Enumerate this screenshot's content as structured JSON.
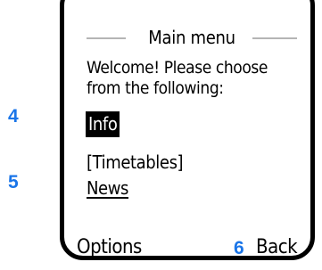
{
  "screen": {
    "title": "Main menu",
    "welcome_line1": "Welcome! Please choose",
    "welcome_line2": "from the following:",
    "menu": [
      {
        "label": "Info"
      },
      {
        "label": "[Timetables]"
      },
      {
        "label": "News"
      }
    ],
    "softkeys": {
      "left": "Options",
      "right": "Back"
    }
  },
  "callouts": [
    "4",
    "5",
    "6"
  ],
  "colors": {
    "callout": "#1a75e8",
    "title_line": "#b5b5b5",
    "highlight_bg": "#000000",
    "highlight_fg": "#ffffff"
  }
}
